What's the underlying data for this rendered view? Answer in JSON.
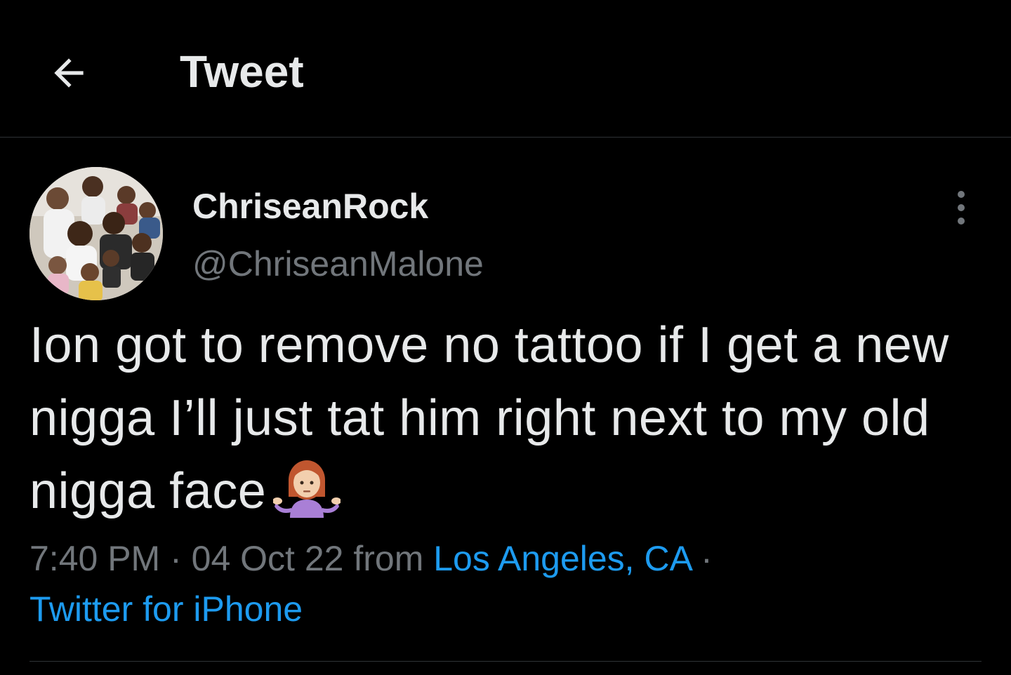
{
  "header": {
    "title": "Tweet",
    "back_icon": "arrow-left-icon"
  },
  "author": {
    "display_name": "ChriseanRock",
    "handle": "@ChriseanMalone",
    "avatar": "family-photo-avatar"
  },
  "more_icon": "more-vertical-icon",
  "tweet": {
    "text": "Ion got to remove no tattoo if I get a new nigga I’ll just tat him right next to my old nigga face",
    "emoji": "woman-shrugging-emoji"
  },
  "meta": {
    "time": "7:40 PM",
    "sep1": " · ",
    "date": "04 Oct 22",
    "from": " from ",
    "location": "Los Angeles, CA",
    "sep2": " ·",
    "source": "Twitter for iPhone"
  },
  "colors": {
    "background": "#000000",
    "text_primary": "#e7e9ea",
    "text_secondary": "#71767b",
    "link": "#1d9bf0",
    "border": "#2f3336"
  }
}
